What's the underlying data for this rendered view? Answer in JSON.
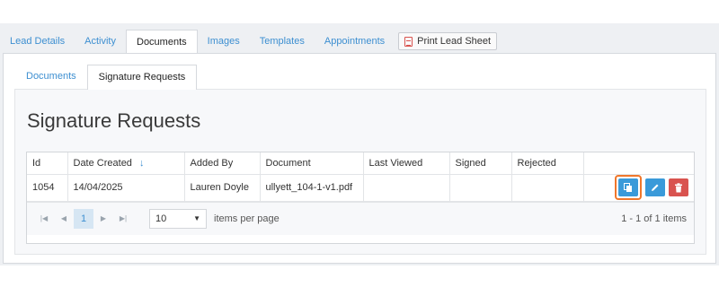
{
  "tabs": [
    "Lead Details",
    "Activity",
    "Documents",
    "Images",
    "Templates",
    "Appointments"
  ],
  "active_tab": "Documents",
  "print_button": "Print Lead Sheet",
  "subtabs": [
    "Documents",
    "Signature Requests"
  ],
  "active_subtab": "Signature Requests",
  "page_title": "Signature Requests",
  "columns": [
    "Id",
    "Date Created",
    "Added By",
    "Document",
    "Last Viewed",
    "Signed",
    "Rejected"
  ],
  "sort_indicator": "↓",
  "rows": [
    {
      "id": "1054",
      "date_created": "14/04/2025",
      "added_by": "Lauren Doyle",
      "document": "ullyett_104-1-v1.pdf",
      "last_viewed": "",
      "signed": "",
      "rejected": ""
    }
  ],
  "pager": {
    "current_page": "1",
    "page_size": "10",
    "per_page_label": "items per page",
    "range_text": "1 - 1 of 1 items"
  },
  "colors": {
    "accent": "#3d8fd1",
    "action_blue": "#3a9ad9",
    "action_red": "#d9534f",
    "highlight": "#f0772b"
  }
}
